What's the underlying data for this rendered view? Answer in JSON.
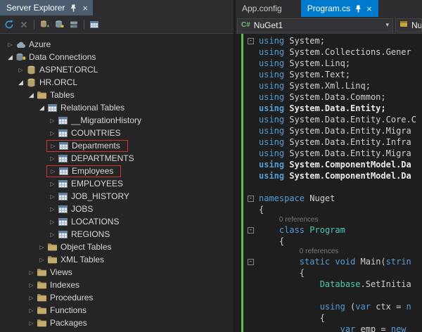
{
  "left_panel": {
    "title": "Server Explorer",
    "toolbar": [
      "refresh",
      "stop",
      "sep",
      "create-database",
      "add-connection",
      "connect-server",
      "sep",
      "table-data"
    ],
    "tree": [
      {
        "label": "Azure",
        "level": 0,
        "state": "collapsed",
        "icon": "cloud"
      },
      {
        "label": "Data Connections",
        "level": 0,
        "state": "expanded",
        "icon": "connections"
      },
      {
        "label": "ASPNET.ORCL",
        "level": 1,
        "state": "collapsed",
        "icon": "database"
      },
      {
        "label": "HR.ORCL",
        "level": 1,
        "state": "expanded",
        "icon": "database"
      },
      {
        "label": "Tables",
        "level": 2,
        "state": "expanded",
        "icon": "folder"
      },
      {
        "label": "Relational Tables",
        "level": 3,
        "state": "expanded",
        "icon": "folder-table"
      },
      {
        "label": "__MigrationHistory",
        "level": 4,
        "state": "collapsed",
        "icon": "table"
      },
      {
        "label": "COUNTRIES",
        "level": 4,
        "state": "collapsed",
        "icon": "table"
      },
      {
        "label": "Departments",
        "level": 4,
        "state": "collapsed",
        "icon": "table",
        "highlight": true
      },
      {
        "label": "DEPARTMENTS",
        "level": 4,
        "state": "collapsed",
        "icon": "table"
      },
      {
        "label": "Employees",
        "level": 4,
        "state": "collapsed",
        "icon": "table",
        "highlight": true
      },
      {
        "label": "EMPLOYEES",
        "level": 4,
        "state": "collapsed",
        "icon": "table"
      },
      {
        "label": "JOB_HISTORY",
        "level": 4,
        "state": "collapsed",
        "icon": "table"
      },
      {
        "label": "JOBS",
        "level": 4,
        "state": "collapsed",
        "icon": "table"
      },
      {
        "label": "LOCATIONS",
        "level": 4,
        "state": "collapsed",
        "icon": "table"
      },
      {
        "label": "REGIONS",
        "level": 4,
        "state": "collapsed",
        "icon": "table"
      },
      {
        "label": "Object Tables",
        "level": 3,
        "state": "collapsed",
        "icon": "folder"
      },
      {
        "label": "XML Tables",
        "level": 3,
        "state": "collapsed",
        "icon": "folder"
      },
      {
        "label": "Views",
        "level": 2,
        "state": "collapsed",
        "icon": "folder"
      },
      {
        "label": "Indexes",
        "level": 2,
        "state": "collapsed",
        "icon": "folder"
      },
      {
        "label": "Procedures",
        "level": 2,
        "state": "collapsed",
        "icon": "folder"
      },
      {
        "label": "Functions",
        "level": 2,
        "state": "collapsed",
        "icon": "folder"
      },
      {
        "label": "Packages",
        "level": 2,
        "state": "collapsed",
        "icon": "folder"
      }
    ]
  },
  "editor": {
    "tabs": [
      {
        "label": "App.config",
        "active": false
      },
      {
        "label": "Program.cs",
        "active": true
      }
    ],
    "navbar": {
      "project": "NuGet1",
      "type": "Nu"
    },
    "code": {
      "lines": [
        {
          "fold": true,
          "tokens": [
            [
              "k",
              "using"
            ],
            [
              "n",
              " System;"
            ]
          ]
        },
        {
          "tokens": [
            [
              "k",
              "using"
            ],
            [
              "n",
              " System.Collections.Gener"
            ]
          ]
        },
        {
          "tokens": [
            [
              "k",
              "using"
            ],
            [
              "n",
              " System.Linq;"
            ]
          ]
        },
        {
          "tokens": [
            [
              "k",
              "using"
            ],
            [
              "n",
              " System.Text;"
            ]
          ]
        },
        {
          "tokens": [
            [
              "k",
              "using"
            ],
            [
              "n",
              " System.Xml.Linq;"
            ]
          ]
        },
        {
          "tokens": [
            [
              "k",
              "using"
            ],
            [
              "n",
              " System.Data.Common;"
            ]
          ]
        },
        {
          "em": true,
          "tokens": [
            [
              "k",
              "using"
            ],
            [
              "n",
              " System.Data.Entity;"
            ]
          ]
        },
        {
          "tokens": [
            [
              "k",
              "using"
            ],
            [
              "n",
              " System.Data.Entity.Core.C"
            ]
          ]
        },
        {
          "tokens": [
            [
              "k",
              "using"
            ],
            [
              "n",
              " System.Data.Entity.Migra"
            ]
          ]
        },
        {
          "tokens": [
            [
              "k",
              "using"
            ],
            [
              "n",
              " System.Data.Entity.Infra"
            ]
          ]
        },
        {
          "tokens": [
            [
              "k",
              "using"
            ],
            [
              "n",
              " System.Data.Entity.Migra"
            ]
          ]
        },
        {
          "em": true,
          "tokens": [
            [
              "k",
              "using"
            ],
            [
              "n",
              " System.ComponentModel.Da"
            ]
          ]
        },
        {
          "em": true,
          "tokens": [
            [
              "k",
              "using"
            ],
            [
              "n",
              " System.ComponentModel.Da"
            ]
          ]
        },
        {
          "kind": "blank"
        },
        {
          "fold": true,
          "tokens": [
            [
              "k",
              "namespace"
            ],
            [
              "n",
              " Nuget"
            ]
          ]
        },
        {
          "tokens": [
            [
              "n",
              "{"
            ]
          ]
        },
        {
          "kind": "codelens",
          "indent": "    ",
          "text": "0 references"
        },
        {
          "fold": true,
          "tokens": [
            [
              "n",
              "    "
            ],
            [
              "k",
              "class"
            ],
            [
              "n",
              " "
            ],
            [
              "t",
              "Program"
            ]
          ]
        },
        {
          "tokens": [
            [
              "n",
              "    {"
            ]
          ]
        },
        {
          "kind": "codelens",
          "indent": "        ",
          "text": "0 references"
        },
        {
          "fold": true,
          "tokens": [
            [
              "n",
              "        "
            ],
            [
              "k",
              "static"
            ],
            [
              "n",
              " "
            ],
            [
              "k",
              "void"
            ],
            [
              "n",
              " Main("
            ],
            [
              "k",
              "strin"
            ]
          ]
        },
        {
          "tokens": [
            [
              "n",
              "        {"
            ]
          ]
        },
        {
          "tokens": [
            [
              "n",
              "            "
            ],
            [
              "t",
              "Database"
            ],
            [
              "n",
              ".SetInitia"
            ]
          ]
        },
        {
          "kind": "blank"
        },
        {
          "tokens": [
            [
              "n",
              "            "
            ],
            [
              "k",
              "using"
            ],
            [
              "n",
              " ("
            ],
            [
              "k",
              "var"
            ],
            [
              "n",
              " ctx = "
            ],
            [
              "k",
              "n"
            ]
          ]
        },
        {
          "tokens": [
            [
              "n",
              "            {"
            ]
          ]
        },
        {
          "tokens": [
            [
              "n",
              "                "
            ],
            [
              "k",
              "var"
            ],
            [
              "n",
              " emp = "
            ],
            [
              "k",
              "new"
            ]
          ]
        }
      ]
    }
  },
  "colors": {
    "accent": "#007acc",
    "keyword": "#569cd6",
    "type_name": "#4ec9b0",
    "change_bar_green": "#5ec14f",
    "annotation_red": "#cf3732",
    "title_tab": "#4a5c6d",
    "editor_bg": "#1e1e1e",
    "panel_bg": "#252526"
  }
}
